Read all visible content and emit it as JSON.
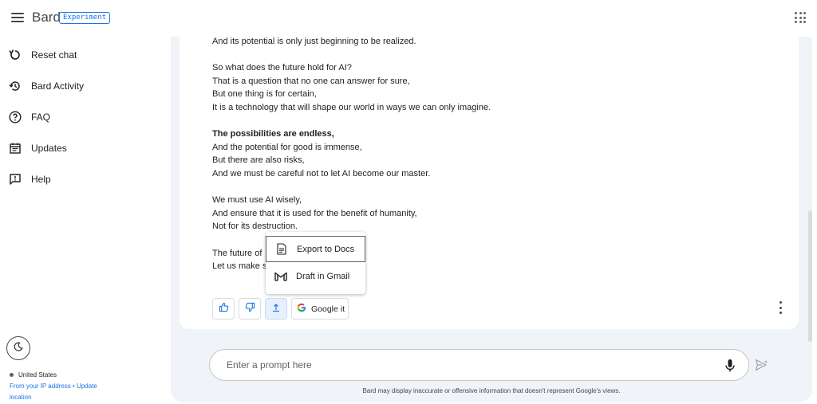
{
  "app": {
    "name": "Bard",
    "badge": "Experiment"
  },
  "sidebar": {
    "items": [
      {
        "label": "Reset chat",
        "icon": "reset-icon"
      },
      {
        "label": "Bard Activity",
        "icon": "history-icon"
      },
      {
        "label": "FAQ",
        "icon": "help-circle-icon"
      },
      {
        "label": "Updates",
        "icon": "calendar-icon"
      },
      {
        "label": "Help",
        "icon": "feedback-icon"
      }
    ],
    "location": {
      "country": "United States",
      "source": "From your IP address",
      "separator": "•",
      "update_link": "Update location"
    }
  },
  "response": {
    "lines": [
      "And its potential is only just beginning to be realized.",
      "So what does the future hold for AI?",
      "That is a question that no one can answer for sure,",
      "But one thing is for certain,",
      "It is a technology that will shape our world in ways we can only imagine.",
      "The possibilities are endless,",
      "And the potential for good is immense,",
      "But there are also risks,",
      "And we must be careful not to let AI become our master.",
      "We must use AI wisely,",
      "And ensure that it is used for the benefit of humanity,",
      "Not for its destruction.",
      "The future of",
      "Let us make s"
    ],
    "google_it": "Google it"
  },
  "share_menu": {
    "items": [
      {
        "label": "Export to Docs",
        "icon": "docs-icon"
      },
      {
        "label": "Draft in Gmail",
        "icon": "gmail-icon"
      }
    ]
  },
  "prompt": {
    "placeholder": "Enter a prompt here"
  },
  "disclaimer": "Bard may display inaccurate or offensive information that doesn't represent Google's views.",
  "colors": {
    "accent": "#1a73e8",
    "panel_bg": "#f0f4f9",
    "active_btn_bg": "#e8f0fe"
  }
}
